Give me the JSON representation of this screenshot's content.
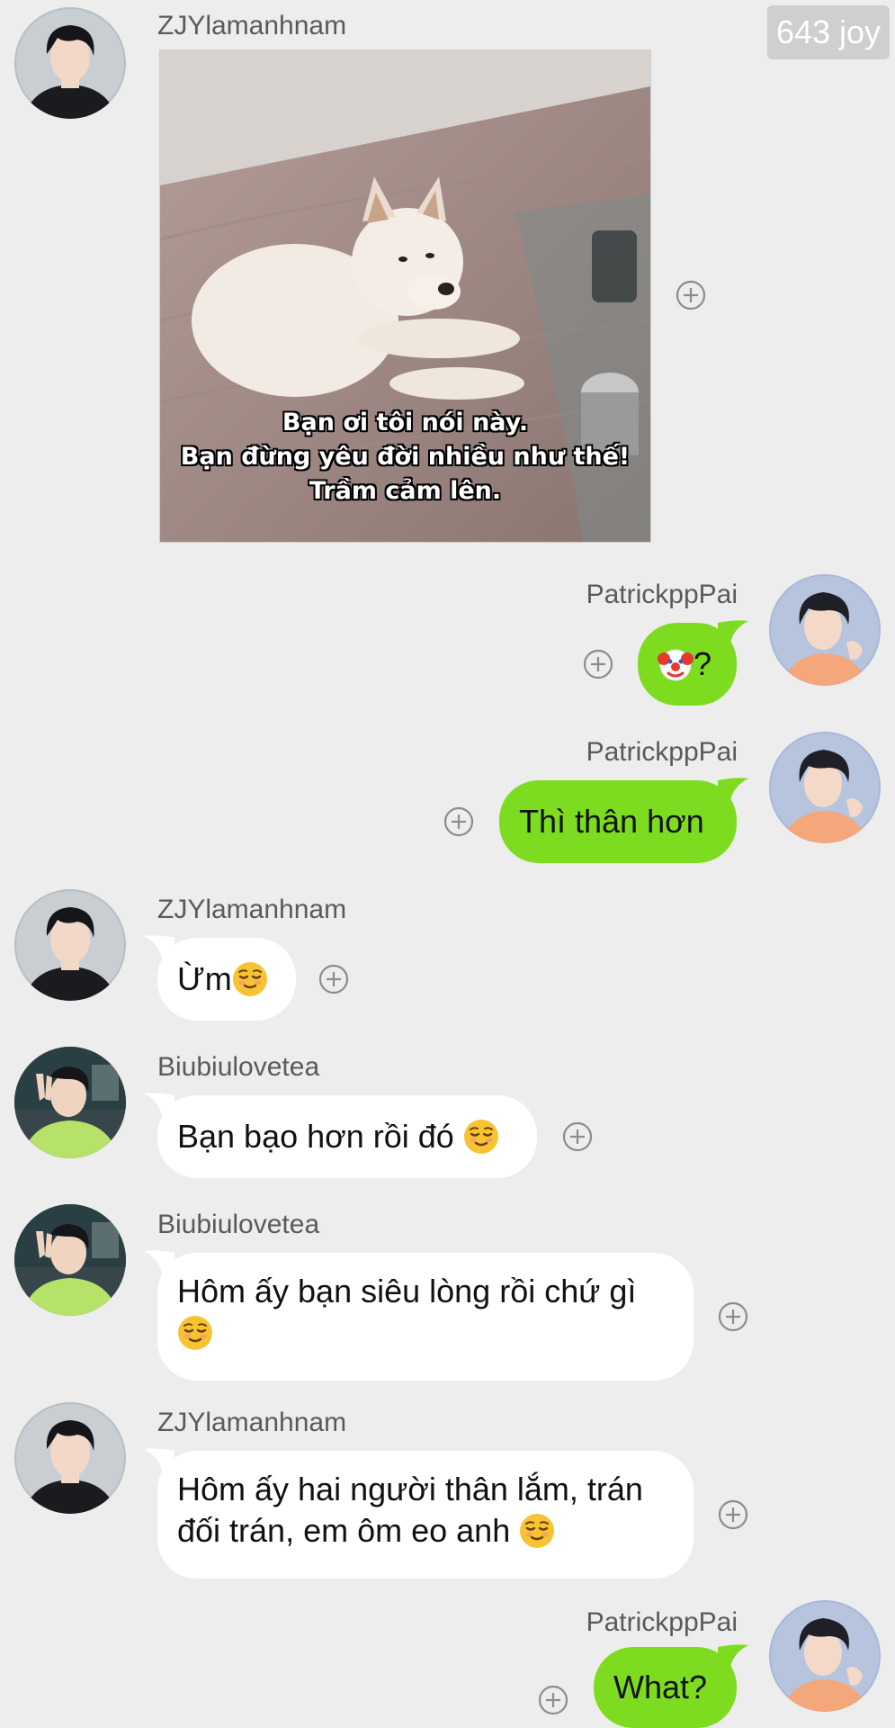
{
  "joy_badge": "643 joy",
  "messages": [
    {
      "user": "ZJYlamanhnam",
      "type": "image",
      "image_caption": [
        "Bạn ơi tôi nói này.",
        "Bạn đừng yêu đời nhiều như thế!",
        "Trầm cảm lên."
      ]
    },
    {
      "user": "PatrickppPai",
      "text": "?"
    },
    {
      "user": "PatrickppPai",
      "text": "Thì thân hơn"
    },
    {
      "user": "ZJYlamanhnam",
      "text": "Ừm"
    },
    {
      "user": "Biubiulovetea",
      "text": "Bạn bạo hơn rồi đó "
    },
    {
      "user": "Biubiulovetea",
      "text_line1": "Hôm ấy bạn siêu lòng rồi chứ gì"
    },
    {
      "user": "ZJYlamanhnam",
      "text_line1": "Hôm ấy hai người thân lắm, trán",
      "text_line2": "đối trán, em ôm eo anh "
    },
    {
      "user": "PatrickppPai",
      "text": "What?"
    }
  ],
  "icons": {
    "add": "plus-circle-icon",
    "relieved": "relieved-face-emoji",
    "clown": "clown-face-emoji"
  },
  "colors": {
    "background": "#ededed",
    "incoming_bubble": "#ffffff",
    "outgoing_bubble": "#7ddc1f",
    "username": "#5a5a5a",
    "badge": "#cfcfcf"
  }
}
